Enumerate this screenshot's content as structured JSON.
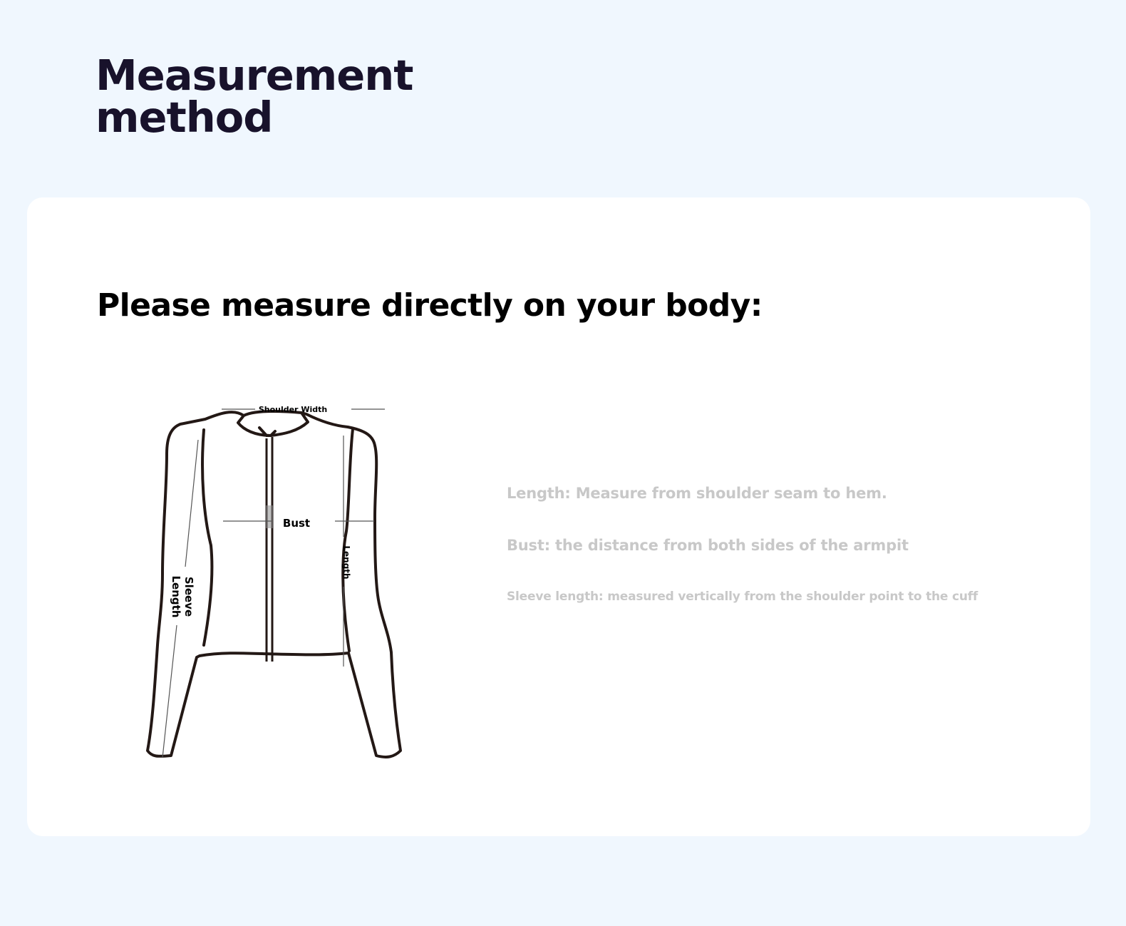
{
  "header": {
    "title_line1": "Measurement",
    "title_line2": "method"
  },
  "card": {
    "heading": "Please measure directly on your body:",
    "diagram": {
      "shoulder_width_label": "Shoulder Width",
      "bust_label": "Bust",
      "length_label": "Length",
      "sleeve_length_label_line1": "Sleeve",
      "sleeve_length_label_line2": "Length"
    },
    "instructions": [
      "Length: Measure from shoulder seam to hem.",
      "Bust: the distance from both sides of the armpit",
      "Sleeve length: measured vertically from the shoulder point to the cuff"
    ]
  },
  "colors": {
    "page_background": "#f0f7fe",
    "card_background": "#ffffff",
    "title_text": "#18122b",
    "heading_text": "#000000",
    "instruction_text": "#c8c8c8",
    "garment_outline": "#231815"
  }
}
